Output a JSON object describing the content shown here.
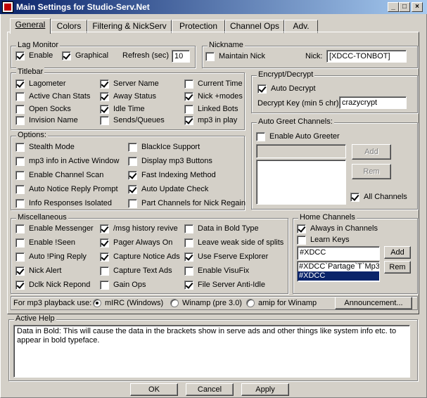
{
  "window": {
    "title": "Main Settings for Studio-Serv.Net",
    "controls": {
      "minimize": "_",
      "maximize": "□",
      "close": "×"
    }
  },
  "tabs": [
    {
      "label": "General",
      "active": true
    },
    {
      "label": "Colors",
      "active": false
    },
    {
      "label": "Filtering & NickServ",
      "active": false
    },
    {
      "label": "Protection",
      "active": false
    },
    {
      "label": "Channel Ops",
      "active": false
    },
    {
      "label": "Adv.",
      "active": false
    }
  ],
  "lag_monitor": {
    "title": "Lag Monitor",
    "enable": {
      "label": "Enable",
      "checked": true
    },
    "graphical": {
      "label": "Graphical",
      "checked": true
    },
    "refresh_label": "Refresh (sec)",
    "refresh_value": "10"
  },
  "nickname": {
    "title": "Nickname",
    "maintain": {
      "label": "Maintain Nick",
      "checked": false
    },
    "nick_label": "Nick:",
    "nick_value": "[XDCC-TONBOT]"
  },
  "titlebar_group": {
    "title": "Titlebar",
    "items": [
      {
        "label": "Lagometer",
        "checked": true
      },
      {
        "label": "Active Chan Stats",
        "checked": false
      },
      {
        "label": "Open Socks",
        "checked": false
      },
      {
        "label": "Invision Name",
        "checked": false
      },
      {
        "label": "Server Name",
        "checked": true
      },
      {
        "label": "Away Status",
        "checked": true
      },
      {
        "label": "Idle Time",
        "checked": true
      },
      {
        "label": "Sends/Queues",
        "checked": false
      },
      {
        "label": "Current Time",
        "checked": false
      },
      {
        "label": "Nick +modes",
        "checked": true
      },
      {
        "label": "Linked Bots",
        "checked": false
      },
      {
        "label": "mp3 in play",
        "checked": true
      }
    ]
  },
  "encrypt": {
    "title": "Encrypt/Decrypt",
    "auto_decrypt": {
      "label": "Auto Decrypt",
      "checked": true
    },
    "key_label": "Decrypt Key (min 5 chr)",
    "key_value": "crazycrypt"
  },
  "options": {
    "title": "Options:",
    "items": [
      {
        "label": "Stealth Mode",
        "checked": false
      },
      {
        "label": "mp3 info in Active Window",
        "checked": false
      },
      {
        "label": "Enable Channel Scan",
        "checked": false
      },
      {
        "label": "Auto Notice Reply Prompt",
        "checked": false
      },
      {
        "label": "Info Responses Isolated",
        "checked": false
      },
      {
        "label": "BlackIce Support",
        "checked": false
      },
      {
        "label": "Display mp3 Buttons",
        "checked": false
      },
      {
        "label": "Fast Indexing Method",
        "checked": true
      },
      {
        "label": "Auto Update Check",
        "checked": true
      },
      {
        "label": "Part Channels for Nick Regain",
        "checked": false
      }
    ]
  },
  "auto_greet": {
    "title": "Auto Greet Channels:",
    "enable": {
      "label": "Enable Auto Greeter",
      "checked": false
    },
    "input_value": "",
    "add_label": "Add",
    "rem_label": "Rem",
    "all_channels": {
      "label": "All Channels",
      "checked": true
    }
  },
  "misc": {
    "title": "Miscellaneous",
    "items": [
      {
        "label": "Enable Messenger",
        "checked": false
      },
      {
        "label": "Enable !Seen",
        "checked": false
      },
      {
        "label": "Auto !Ping Reply",
        "checked": false
      },
      {
        "label": "Nick Alert",
        "checked": true
      },
      {
        "label": "Dclk Nick Repond",
        "checked": true
      },
      {
        "label": "/msg history revive",
        "checked": true
      },
      {
        "label": "Pager Always On",
        "checked": true
      },
      {
        "label": "Capture Notice Ads",
        "checked": true
      },
      {
        "label": "Capture Text Ads",
        "checked": false
      },
      {
        "label": "Gain Ops",
        "checked": false
      },
      {
        "label": "Data in Bold Type",
        "checked": false
      },
      {
        "label": "Leave weak side of splits",
        "checked": false
      },
      {
        "label": "Use Fserve Explorer",
        "checked": true
      },
      {
        "label": "Enable VisuFix",
        "checked": false
      },
      {
        "label": "File Server Anti-Idle",
        "checked": true
      }
    ]
  },
  "home_channels": {
    "title": "Home Channels",
    "always": {
      "label": "Always in Channels",
      "checked": true
    },
    "learn": {
      "label": "Learn Keys",
      "checked": false
    },
    "input_value": "#XDCC",
    "add_label": "Add",
    "rem_label": "Rem",
    "list": [
      {
        "label": "#XDCC`Partage`T`Mp3",
        "selected": false
      },
      {
        "label": "#XDCC",
        "selected": true
      }
    ]
  },
  "mp3_playback": {
    "label": "For mp3 playback use:",
    "options": [
      {
        "label": "mIRC (Windows)",
        "checked": true
      },
      {
        "label": "Winamp (pre 3.0)",
        "checked": false
      },
      {
        "label": "amip for Winamp",
        "checked": false
      }
    ],
    "announcement_label": "Announcement..."
  },
  "active_help": {
    "title": "Active Help",
    "text": "Data in Bold: This will cause the data in the brackets show in serve ads and other things like system info etc. to appear in bold typeface."
  },
  "footer": {
    "ok_label": "OK",
    "cancel_label": "Cancel",
    "apply_label": "Apply"
  }
}
